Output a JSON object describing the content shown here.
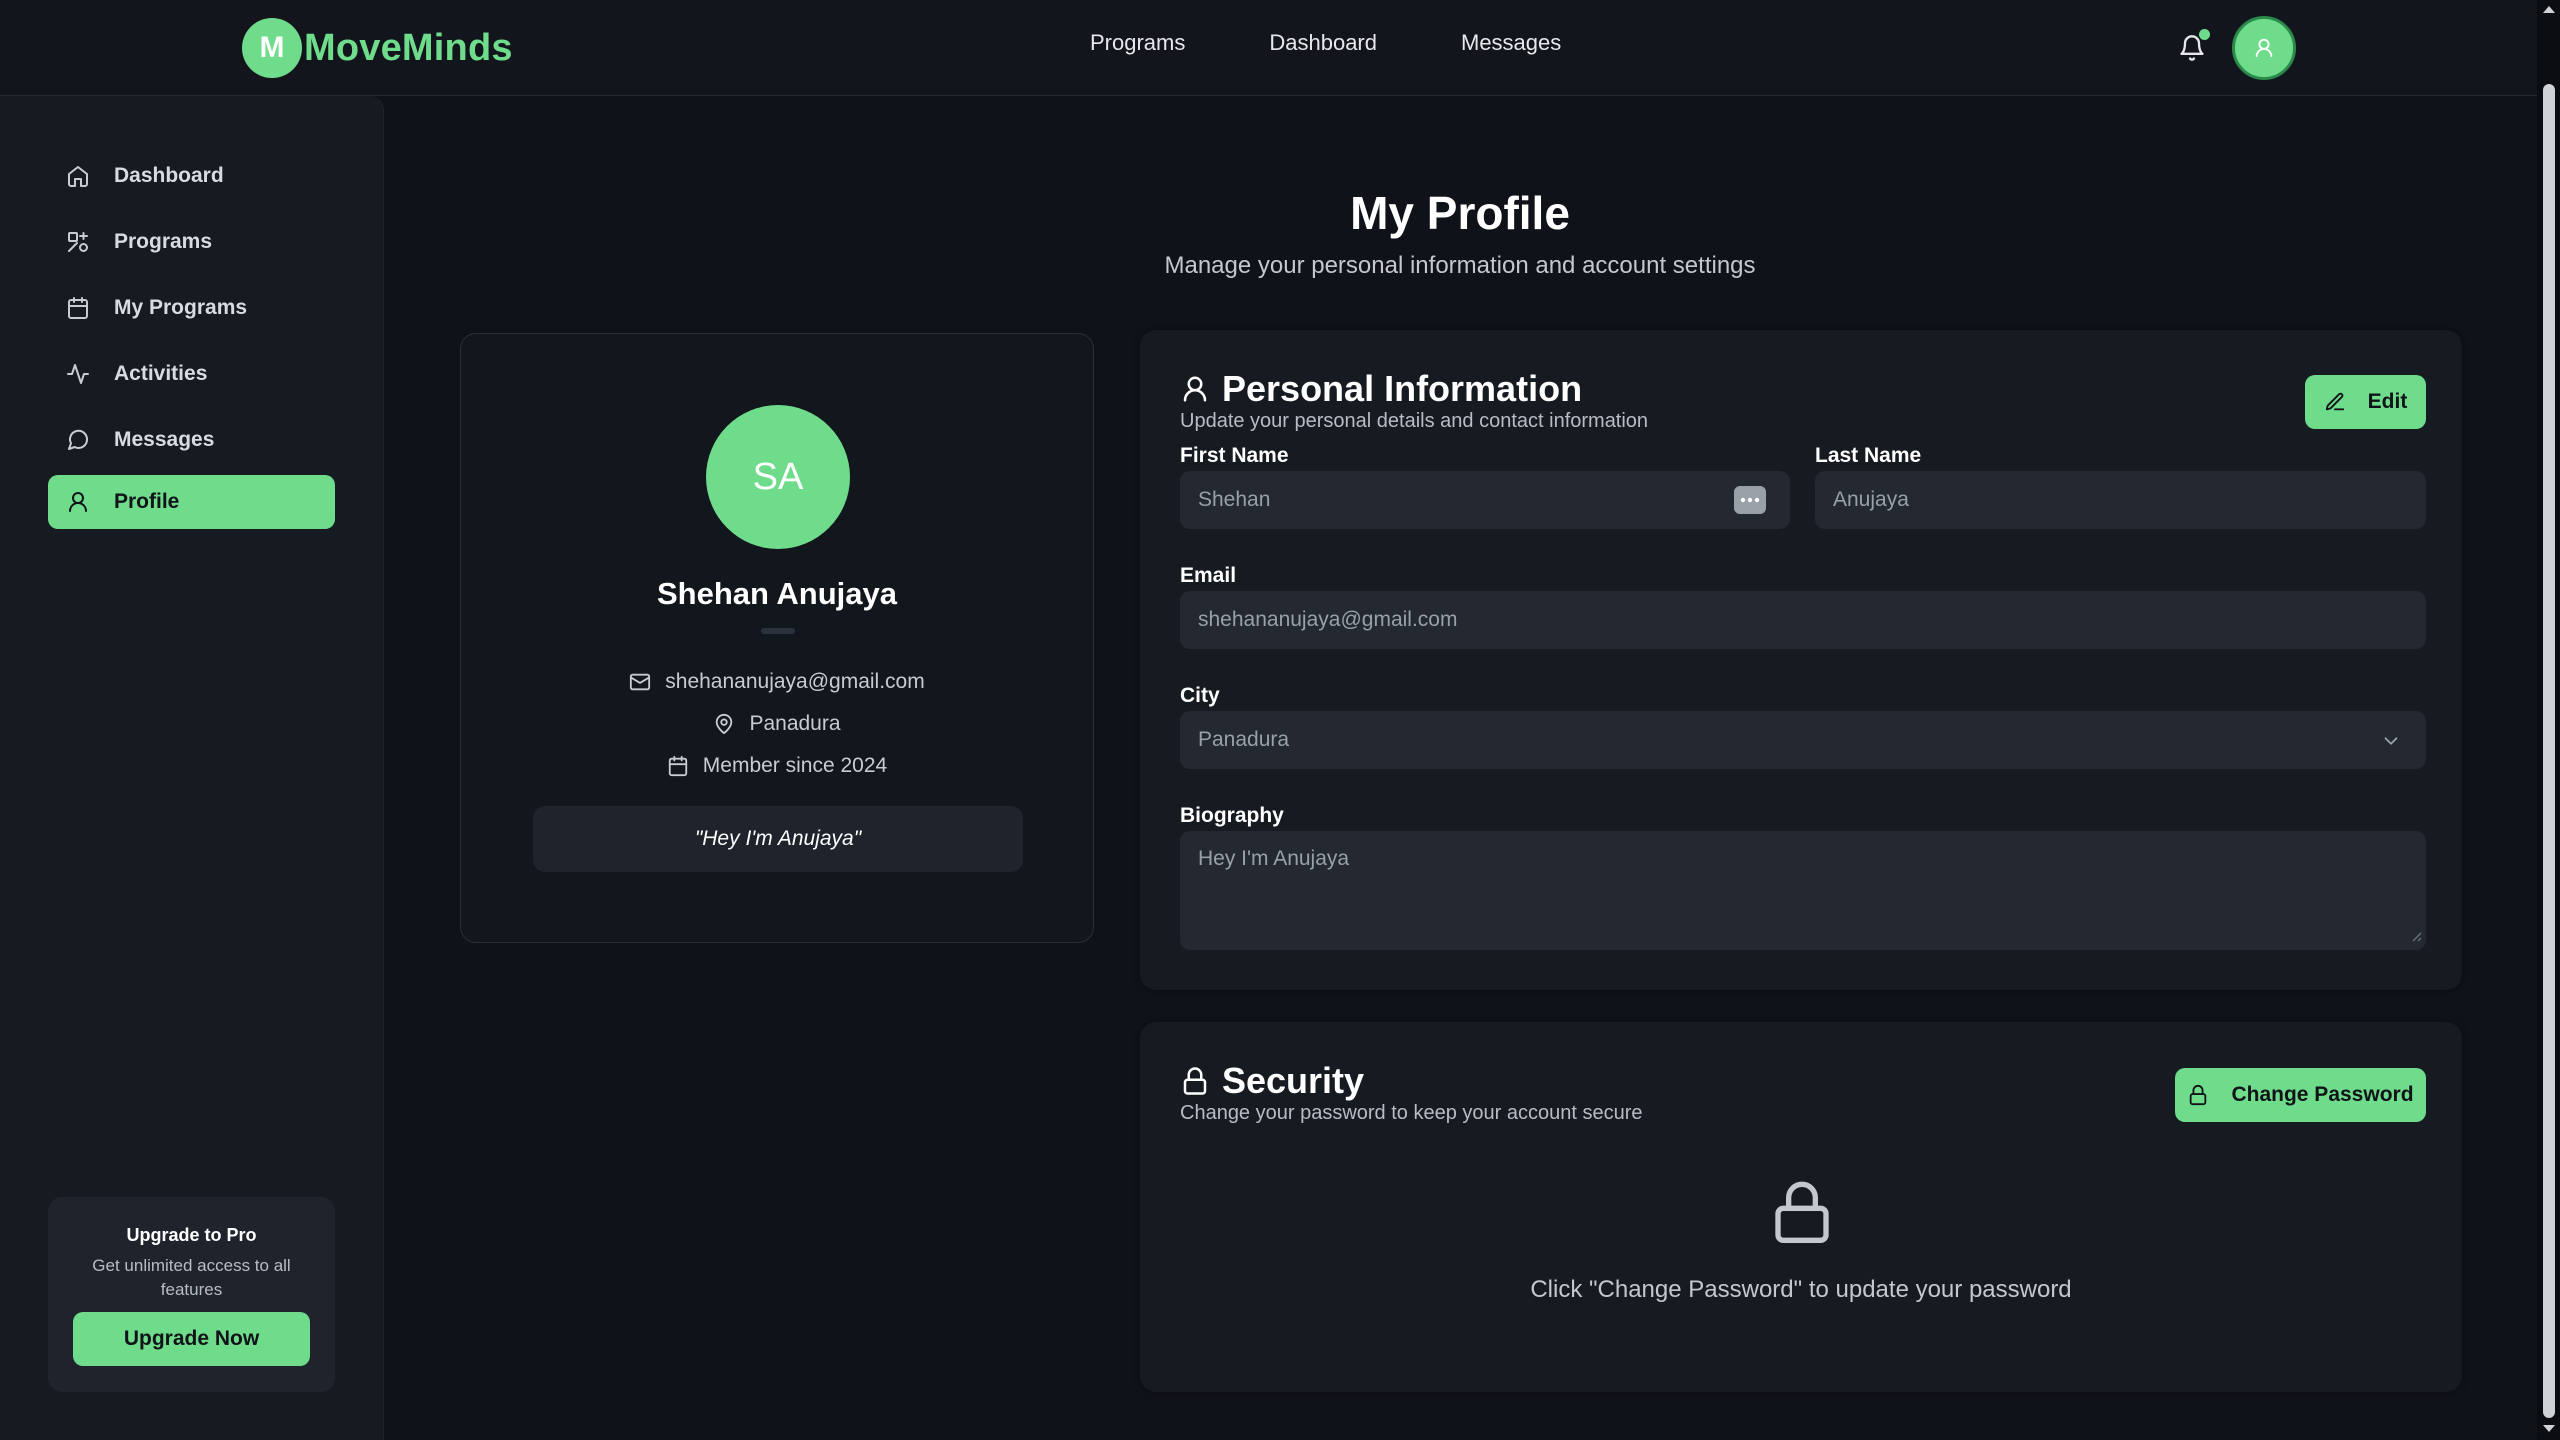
{
  "brand": {
    "badge": "M",
    "name": "MoveMinds",
    "accent": "#6fdc8c"
  },
  "topnav": {
    "programs": "Programs",
    "dashboard": "Dashboard",
    "messages": "Messages"
  },
  "sidebar": {
    "items": [
      {
        "label": "Dashboard",
        "icon": "home-icon"
      },
      {
        "label": "Programs",
        "icon": "programs-icon"
      },
      {
        "label": "My Programs",
        "icon": "calendar-icon"
      },
      {
        "label": "Activities",
        "icon": "activity-icon"
      },
      {
        "label": "Messages",
        "icon": "message-icon"
      },
      {
        "label": "Profile",
        "icon": "user-icon",
        "active": true
      }
    ],
    "upgrade": {
      "title": "Upgrade to Pro",
      "desc": "Get unlimited access to all features",
      "button": "Upgrade Now"
    }
  },
  "page": {
    "title": "My Profile",
    "subtitle": "Manage your personal information and account settings"
  },
  "profile": {
    "initials": "SA",
    "name": "Shehan Anujaya",
    "email": "shehananujaya@gmail.com",
    "city": "Panadura",
    "member_since": "Member since 2024",
    "quote": "\"Hey I'm Anujaya\""
  },
  "personal_info": {
    "title": "Personal Information",
    "desc": "Update your personal details and contact information",
    "edit_label": "Edit",
    "first_name_label": "First Name",
    "first_name": "Shehan",
    "last_name_label": "Last Name",
    "last_name": "Anujaya",
    "email_label": "Email",
    "email": "shehananujaya@gmail.com",
    "city_label": "City",
    "city": "Panadura",
    "bio_label": "Biography",
    "bio": "Hey I'm Anujaya"
  },
  "security": {
    "title": "Security",
    "desc": "Change your password to keep your account secure",
    "button": "Change Password",
    "message": "Click \"Change Password\" to update your password"
  }
}
